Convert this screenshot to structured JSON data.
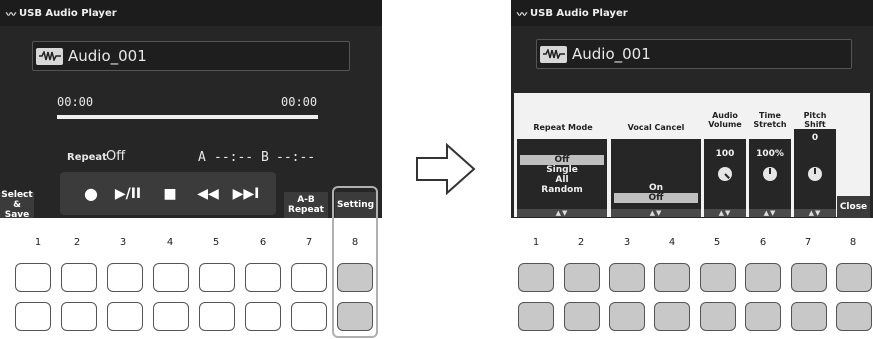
{
  "left": {
    "title": "USB Audio Player",
    "song": "Audio_001",
    "time_current": "00:00",
    "time_total": "00:00",
    "progress": 0,
    "repeat_label": "Repeat",
    "repeat_value": "Off",
    "a_label": "A",
    "a_value": "--:--",
    "b_label": "B",
    "b_value": "--:--",
    "select_save": "Select & Save",
    "transport": {
      "rec": "●",
      "play_pause": "▶/II",
      "stop": "■",
      "rewind": "◀◀",
      "forward": "▶▶I"
    },
    "ab_repeat": "A-B Repeat",
    "setting": "Setting"
  },
  "right": {
    "title": "USB Audio Player",
    "song": "Audio_001",
    "repeat_mode": {
      "header": "Repeat Mode",
      "options": [
        "Off",
        "Single",
        "All",
        "Random"
      ],
      "selected": "Off",
      "arrows": "▲▼"
    },
    "vocal_cancel": {
      "header": "Vocal Cancel",
      "options": [
        "On",
        "Off"
      ],
      "selected": "Off",
      "arrows": "▲▼"
    },
    "audio_volume": {
      "header": "Audio Volume",
      "value": "100",
      "arrows": "▲▼"
    },
    "time_stretch": {
      "header": "Time Stretch",
      "value": "100%",
      "arrows": "▲▼"
    },
    "pitch_shift": {
      "header": "Pitch Shift",
      "value": "0",
      "arrows": "▲▼"
    },
    "close": "Close"
  },
  "button_numbers": [
    "1",
    "2",
    "3",
    "4",
    "5",
    "6",
    "7",
    "8"
  ],
  "icons": {
    "song": "waveform-icon",
    "arrow": "right-arrow-icon"
  },
  "colors": {
    "screen": "#262626",
    "lit_pad": "#c8c8c8",
    "selected_option": "#bfbfbf"
  }
}
